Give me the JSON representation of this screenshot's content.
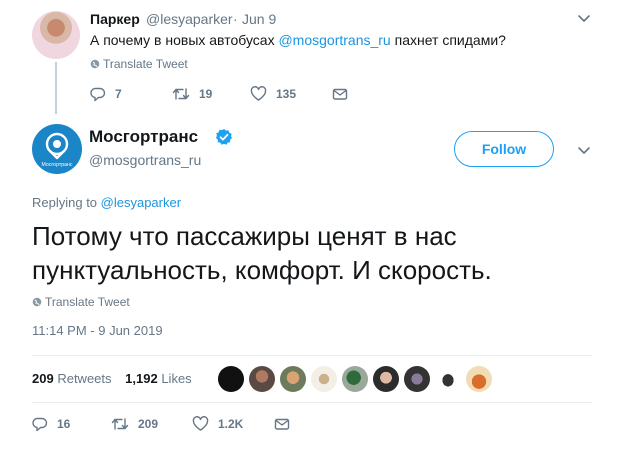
{
  "parent_tweet": {
    "name": "Паркер",
    "handle": "@lesyaparker",
    "separator": "·",
    "date": "Jun 9",
    "text_before": "А почему в новых автобусах ",
    "mention": "@mosgortrans_ru",
    "text_after": " пахнет спидами?",
    "translate": "Translate Tweet",
    "actions": {
      "replies": "7",
      "retweets": "19",
      "likes": "135"
    }
  },
  "main_tweet": {
    "name": "Мосгортранс",
    "handle": "@mosgortrans_ru",
    "avatar_label": "Мосгортранс",
    "follow_label": "Follow",
    "replying_to_label": "Replying to ",
    "replying_to_handle": "@lesyaparker",
    "text": "Потому что пассажиры ценят в нас пунктуальность, комфорт. И скорость.",
    "translate": "Translate Tweet",
    "timestamp": "11:14 PM - 9 Jun 2019",
    "retweets_count": "209",
    "retweets_label": "Retweets",
    "likes_count": "1,192",
    "likes_label": "Likes",
    "actions": {
      "replies": "16",
      "retweets": "209",
      "likes": "1.2K"
    }
  },
  "colors": {
    "link": "#1b95e0",
    "follow": "#1da1f2",
    "muted": "#657786",
    "verified": "#1da1f2"
  }
}
